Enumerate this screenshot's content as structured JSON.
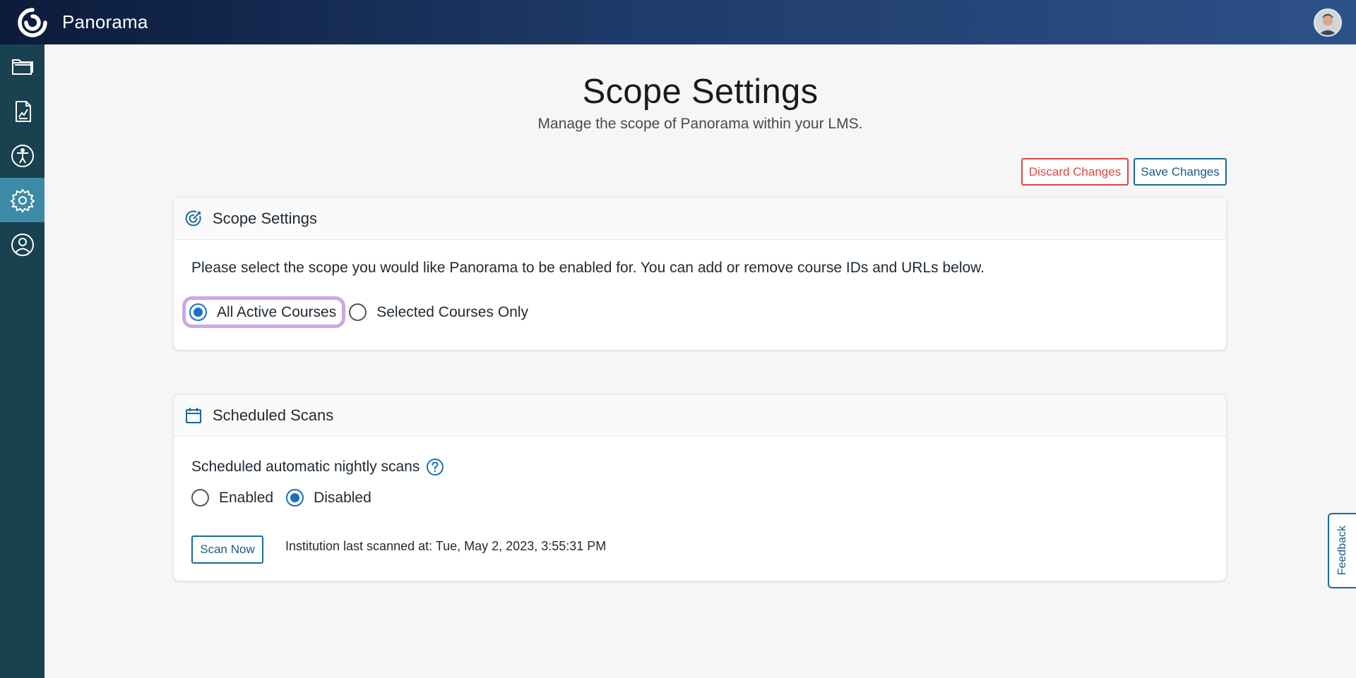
{
  "app": {
    "title": "Panorama"
  },
  "sidebar": {
    "items": [
      {
        "icon": "folder-icon",
        "active": false
      },
      {
        "icon": "report-chart-icon",
        "active": false
      },
      {
        "icon": "accessibility-icon",
        "active": false
      },
      {
        "icon": "gear-icon",
        "active": true
      },
      {
        "icon": "user-circle-icon",
        "active": false
      }
    ]
  },
  "page": {
    "title": "Scope Settings",
    "subtitle": "Manage the scope of Panorama within your LMS."
  },
  "actions": {
    "discard_label": "Discard Changes",
    "save_label": "Save Changes"
  },
  "scope_card": {
    "title": "Scope Settings",
    "icon": "target-icon",
    "description": "Please select the scope you would like Panorama to be enabled for. You can add or remove course IDs and URLs below.",
    "options": [
      {
        "label": "All Active Courses",
        "checked": true
      },
      {
        "label": "Selected Courses Only",
        "checked": false
      }
    ]
  },
  "scans_card": {
    "title": "Scheduled Scans",
    "icon": "calendar-icon",
    "nightly_label": "Scheduled automatic nightly scans",
    "options": [
      {
        "label": "Enabled",
        "checked": false
      },
      {
        "label": "Disabled",
        "checked": true
      }
    ],
    "scan_button_label": "Scan Now",
    "last_scanned": "Institution last scanned at: Tue, May 2, 2023, 3:55:31 PM"
  },
  "feedback": {
    "label": "Feedback"
  },
  "colors": {
    "accent": "#1a6fc4",
    "danger": "#e04545",
    "sidebar": "#19414f",
    "sidebar_active": "#3b8aa6",
    "focus_ring": "#c9a9e3"
  }
}
